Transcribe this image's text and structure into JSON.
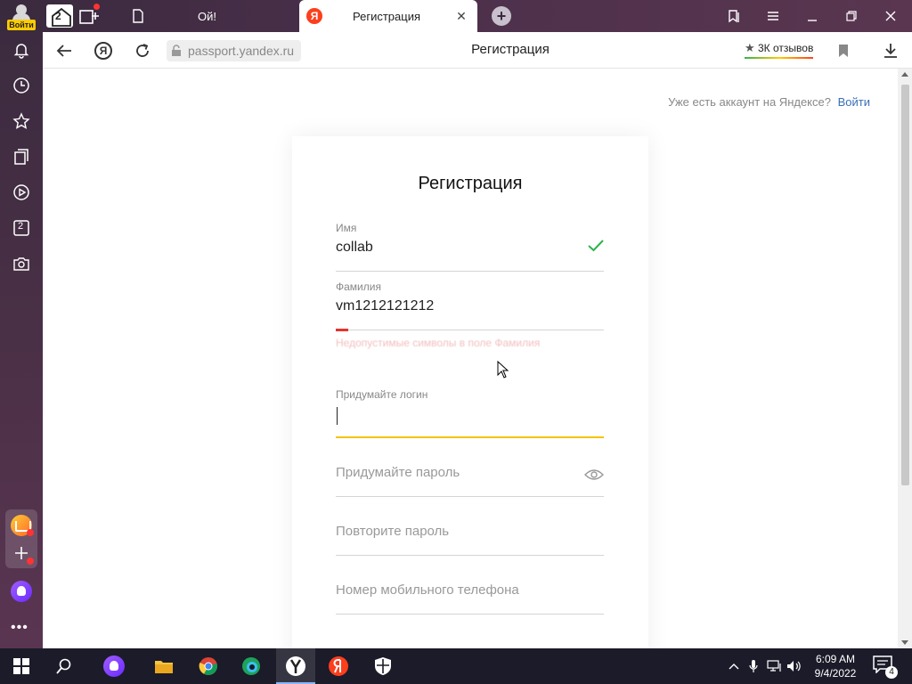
{
  "profile": {
    "login_label": "Войти"
  },
  "home": {
    "tab_count": "2"
  },
  "tabs": [
    {
      "title": "Ой!"
    },
    {
      "title": "Регистрация",
      "favicon_letter": "Я"
    }
  ],
  "addressbar": {
    "url": "passport.yandex.ru",
    "page_title": "Регистрация",
    "reviews": "3К отзывов",
    "ya_button": "Я"
  },
  "sidebar": {
    "badge_number": "2"
  },
  "page": {
    "signin_hint": "Уже есть аккаунт на Яндексе?",
    "signin_link": "Войти",
    "heading": "Регистрация",
    "fields": {
      "first_name": {
        "label": "Имя",
        "value": "collab"
      },
      "last_name": {
        "label": "Фамилия",
        "value": "vm1212121212"
      },
      "login": {
        "label": "Придумайте логин",
        "value": ""
      },
      "password": {
        "placeholder": "Придумайте пароль"
      },
      "password_repeat": {
        "placeholder": "Повторите пароль"
      },
      "phone": {
        "placeholder": "Номер мобильного телефона"
      }
    },
    "error": "Недопустимые символы в поле Фамилия"
  },
  "taskbar": {
    "time": "6:09 AM",
    "date": "9/4/2022",
    "notification_count": "4"
  },
  "colors": {
    "accent_yellow": "#f5c400",
    "error_red": "#e3342f",
    "yandex_red": "#fc3f1d",
    "link_blue": "#3a6fb8",
    "success_green": "#2db34a"
  }
}
